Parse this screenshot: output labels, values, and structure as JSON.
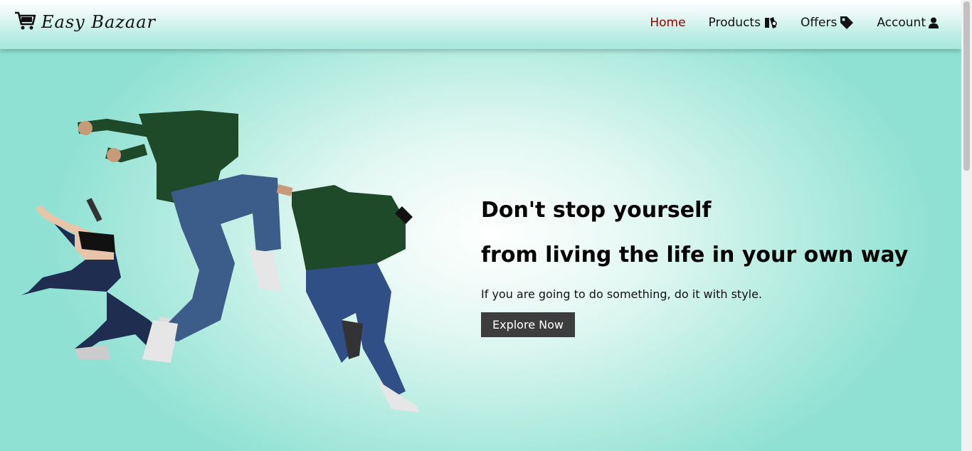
{
  "brand": {
    "name": "Easy Bazaar",
    "logo_icon": "shopping-cart-icon"
  },
  "nav": {
    "items": [
      {
        "label": "Home",
        "icon": "",
        "active": true
      },
      {
        "label": "Products",
        "icon": "products-icon",
        "active": false
      },
      {
        "label": "Offers",
        "icon": "tag-icon",
        "active": false
      },
      {
        "label": "Account",
        "icon": "user-icon",
        "active": false
      }
    ]
  },
  "hero": {
    "heading_line1": "Don't stop yourself",
    "heading_line2": "from living the life in your own way",
    "subtitle": "If you are going to do something, do it with style.",
    "cta_label": "Explore Now"
  },
  "colors": {
    "accent_active": "#8b0000",
    "button_bg": "#3d3d3d",
    "teal": "#8fe1d4"
  }
}
